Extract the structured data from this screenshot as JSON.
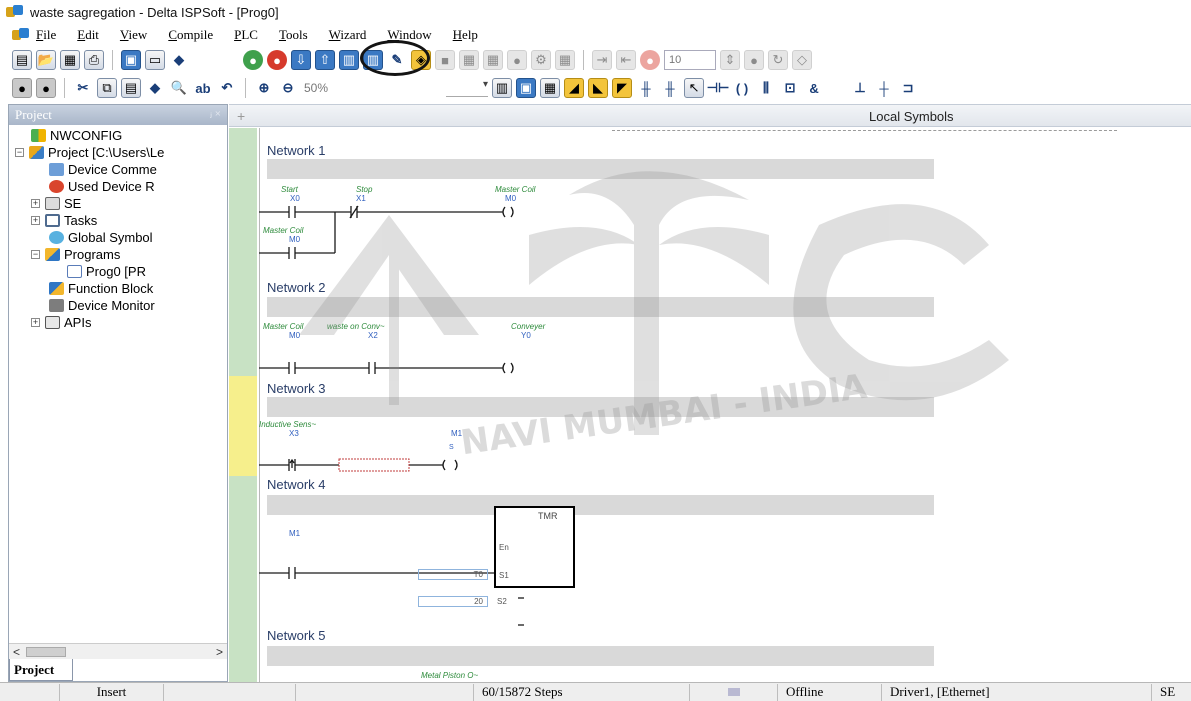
{
  "window": {
    "title": "waste sagregation - Delta ISPSoft - [Prog0]"
  },
  "menu": [
    "File",
    "Edit",
    "View",
    "Compile",
    "PLC",
    "Tools",
    "Wizard",
    "Window",
    "Help"
  ],
  "toolbar": {
    "spin_value": "10",
    "zoom": "50%"
  },
  "project_panel": {
    "title": "Project",
    "pin": "ⱼ ×",
    "items": [
      {
        "label": "NWCONFIG",
        "icon": "network-config-icon"
      },
      {
        "label": "Project [C:\\Users\\Le",
        "icon": "project-folder-icon"
      },
      {
        "label": "Device Comme",
        "icon": "device-comment-icon"
      },
      {
        "label": "Used Device R",
        "icon": "used-device-icon"
      },
      {
        "label": "SE",
        "icon": "table-icon"
      },
      {
        "label": "Tasks",
        "icon": "tasks-icon"
      },
      {
        "label": "Global Symbol",
        "icon": "global-symbol-icon"
      },
      {
        "label": "Programs",
        "icon": "programs-icon"
      },
      {
        "label": "Prog0 [PR",
        "icon": "program-icon"
      },
      {
        "label": "Function Block",
        "icon": "function-block-icon"
      },
      {
        "label": "Device Monitor",
        "icon": "device-monitor-icon"
      },
      {
        "label": "APIs",
        "icon": "apis-icon"
      }
    ],
    "scroll_left": "<",
    "scroll_right": ">",
    "tab": "Project"
  },
  "editor": {
    "header": "Local Symbols",
    "networks": [
      {
        "label": "Network 1"
      },
      {
        "label": "Network 2"
      },
      {
        "label": "Network 3"
      },
      {
        "label": "Network 4"
      },
      {
        "label": "Network 5"
      }
    ],
    "n1": {
      "start_sym": "Start",
      "start_addr": "X0",
      "stop_sym": "Stop",
      "stop_addr": "X1",
      "coil_sym": "Master Coil",
      "coil_addr": "M0",
      "hold_sym": "Master Coil",
      "hold_addr": "M0"
    },
    "n2": {
      "c1_sym": "Master Coil",
      "c1_addr": "M0",
      "c2_sym": "waste on Conv~",
      "c2_addr": "X2",
      "coil_sym": "Conveyer",
      "coil_addr": "Y0"
    },
    "n3": {
      "c1_sym": "Inductive Sens~",
      "c1_addr": "X3",
      "coil_addr": "M1",
      "coil_type": "S"
    },
    "n4": {
      "c1_addr": "M1",
      "block_name": "TMR",
      "pin_en": "En",
      "pin_s1": "S1",
      "pin_s2": "S2",
      "s1_value": "T0",
      "s2_value": "20"
    },
    "n5": {
      "sym": "Metal Piston O~"
    }
  },
  "watermark": {
    "line1": "NAVI MUMBAI - INDIA",
    "logo": "AKTC"
  },
  "status": {
    "mode": "Insert",
    "steps": "60/15872 Steps",
    "connection": "Offline",
    "driver": "Driver1, [Ethernet]",
    "tail": "SE"
  }
}
